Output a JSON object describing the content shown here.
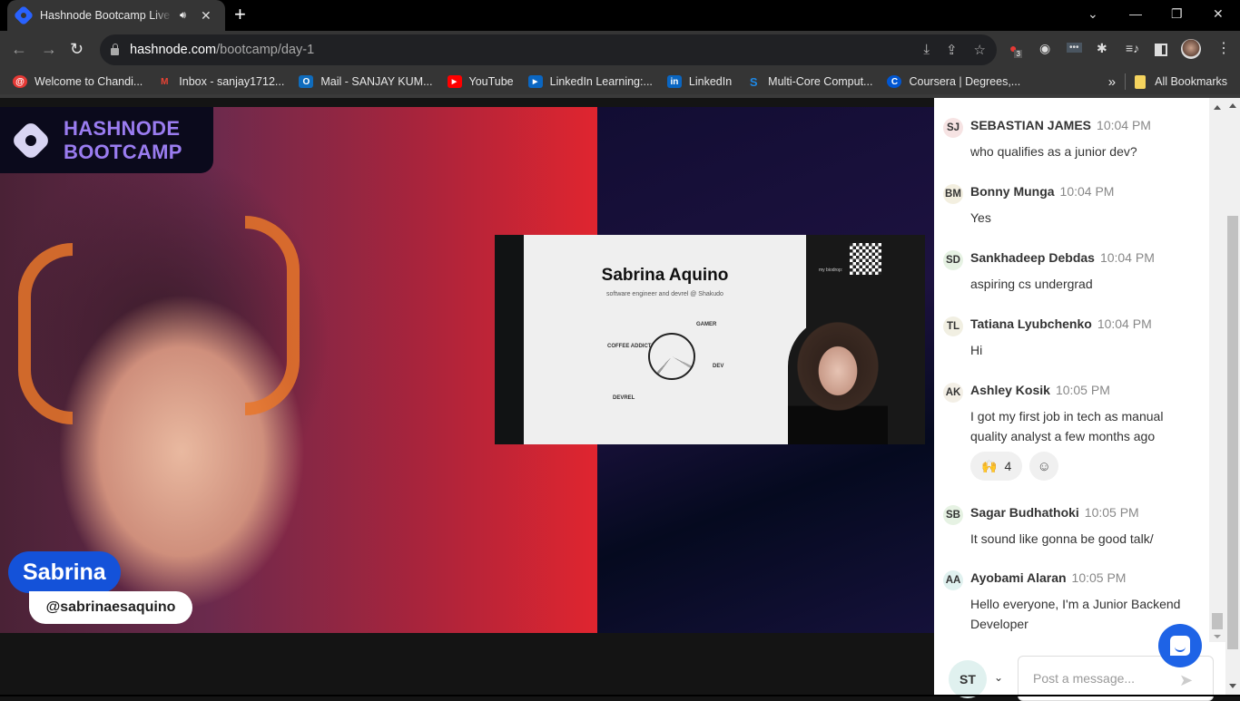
{
  "browser": {
    "tab": {
      "title": "Hashnode Bootcamp Live Stream",
      "favicon": "hashnode-icon",
      "audio_icon": "speaker-icon"
    },
    "new_tab_label": "+",
    "window_controls": {
      "tab_search": "⌄",
      "minimize": "—",
      "restore": "❐",
      "close": "✕"
    },
    "nav": {
      "back": "←",
      "forward": "→",
      "reload": "↻"
    },
    "url": {
      "host": "hashnode.com",
      "path": "/bootcamp/day-1"
    },
    "omnibox_icons": [
      "install-icon",
      "share-icon",
      "star-icon"
    ],
    "extensions": [
      {
        "name": "extension-red-icon",
        "badge": "3"
      },
      {
        "name": "extension-ear-icon"
      },
      {
        "name": "extension-dots-icon"
      },
      {
        "name": "puzzle-icon"
      },
      {
        "name": "media-queue-icon"
      },
      {
        "name": "side-panel-icon"
      },
      {
        "name": "profile-avatar"
      },
      {
        "name": "menu-kebab-icon"
      }
    ],
    "bookmarks": [
      {
        "label": "Welcome to Chandi...",
        "icon": "@",
        "color": "#e53935"
      },
      {
        "label": "Inbox - sanjay1712...",
        "icon": "M",
        "color": "#ea4335"
      },
      {
        "label": "Mail - SANJAY KUM...",
        "icon": "O",
        "color": "#0f6cbd"
      },
      {
        "label": "YouTube",
        "icon": "▶",
        "color": "#ff0000"
      },
      {
        "label": "LinkedIn Learning:...",
        "icon": "▶",
        "color": "#0a66c2"
      },
      {
        "label": "LinkedIn",
        "icon": "in",
        "color": "#0a66c2"
      },
      {
        "label": "Multi-Core Comput...",
        "icon": "S",
        "color": "#1e88e5"
      },
      {
        "label": "Coursera | Degrees,...",
        "icon": "C",
        "color": "#0056d2"
      }
    ],
    "bookmarks_overflow": "»",
    "all_bookmarks": "All Bookmarks"
  },
  "video": {
    "brand_line1": "HASHNODE",
    "brand_line2": "BOOTCAMP",
    "speaker_name": "Sabrina",
    "speaker_handle": "@sabrinaesaquino",
    "slide": {
      "title": "Sabrina Aquino",
      "subtitle": "software engineer and devrel @ Shakudo",
      "pie_labels": [
        "GAMER",
        "COFFEE ADDICT",
        "DEV",
        "DEVREL"
      ],
      "qr_caption": "my biodrop:"
    }
  },
  "chat": {
    "messages": [
      {
        "initials": "SJ",
        "name": "SEBASTIAN JAMES",
        "time": "10:04 PM",
        "text": "who qualifies as a junior dev?",
        "avatar_color": "#f6e3e3"
      },
      {
        "initials": "BM",
        "name": "Bonny Munga",
        "time": "10:04 PM",
        "text": "Yes",
        "avatar_color": "#f3efe0"
      },
      {
        "initials": "SD",
        "name": "Sankhadeep Debdas",
        "time": "10:04 PM",
        "text": "aspiring cs undergrad",
        "avatar_color": "#e6f2e3"
      },
      {
        "initials": "TL",
        "name": "Tatiana Lyubchenko",
        "time": "10:04 PM",
        "text": "Hi",
        "avatar_color": "#f1efe2"
      },
      {
        "initials": "AK",
        "name": "Ashley Kosik",
        "time": "10:05 PM",
        "text": "I got my first job in tech as manual quality analyst a few months ago",
        "avatar_color": "#f3efe6",
        "reaction": {
          "emoji": "🙌",
          "count": "4"
        }
      },
      {
        "initials": "SB",
        "name": "Sagar Budhathoki",
        "time": "10:05 PM",
        "text": "It sound like gonna be good talk/",
        "avatar_color": "#e6f2e3"
      },
      {
        "initials": "AA",
        "name": "Ayobami Alaran",
        "time": "10:05 PM",
        "text": "Hello everyone, I'm a Junior Backend Developer",
        "avatar_color": "#e0f1ef"
      }
    ],
    "composer": {
      "my_initials": "ST",
      "chevron": "⌄",
      "placeholder": "Post a message...",
      "send_icon": "➤"
    },
    "add_reaction_icon": "☺"
  },
  "colors": {
    "accent": "#1e63e6",
    "brand_purple": "#9a7cf0",
    "name_tag": "#1452d9"
  }
}
